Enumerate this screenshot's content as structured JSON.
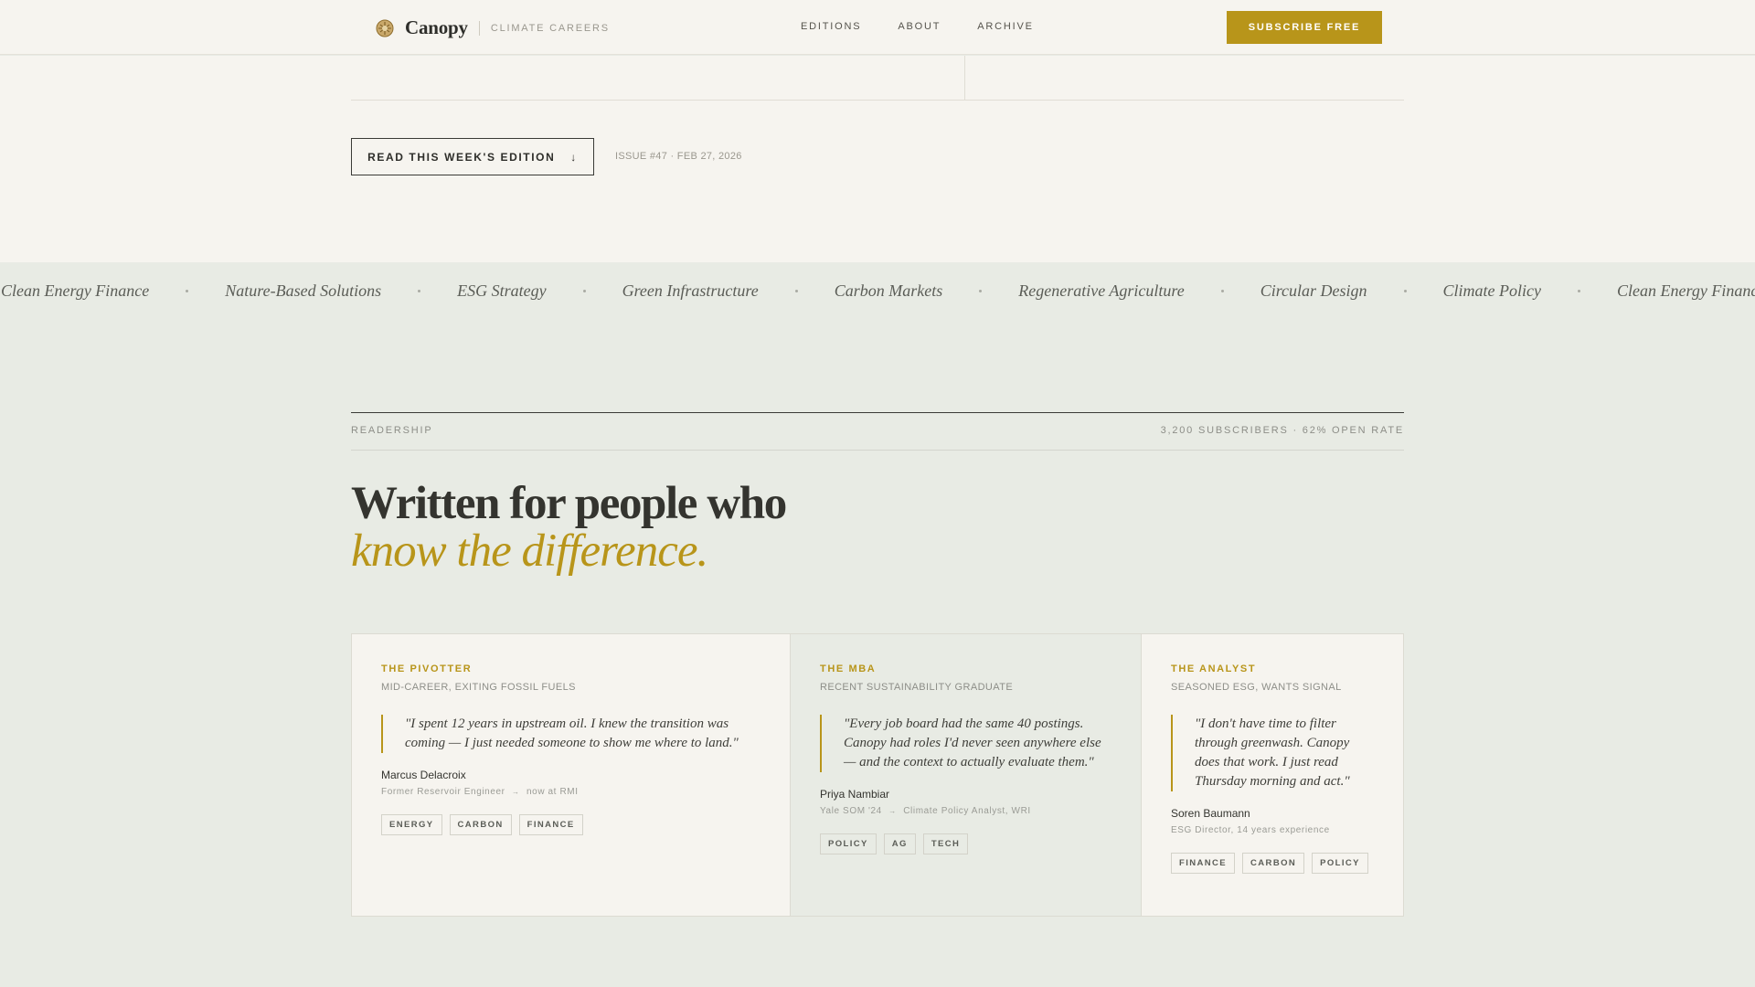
{
  "nav": {
    "brand": "Canopy",
    "tagline": "CLIMATE CAREERS",
    "links": [
      "EDITIONS",
      "ABOUT",
      "ARCHIVE"
    ],
    "cta": "SUBSCRIBE FREE",
    "logo_icon": "leaf-emblem-icon",
    "accent": "#b8951a"
  },
  "hero": {
    "read_button": "READ THIS WEEK'S EDITION",
    "read_arrow": "↓",
    "issue": "ISSUE #47 · FEB 27, 2026"
  },
  "ticker": [
    "Clean Energy Finance",
    "Nature-Based Solutions",
    "ESG Strategy",
    "Green Infrastructure",
    "Carbon Markets",
    "Regenerative Agriculture",
    "Circular Design",
    "Climate Policy",
    "Clean Energy Finance"
  ],
  "readership": {
    "label": "READERSHIP",
    "stats": "3,200 SUBSCRIBERS · 62% OPEN RATE",
    "headline": "Written for people who",
    "headline_em": "know the difference."
  },
  "cards": [
    {
      "role": "THE PIVOTTER",
      "subtitle": "MID-CAREER, EXITING FOSSIL FUELS",
      "quote": "\"I spent 12 years in upstream oil. I knew the transition was coming — I just needed someone to show me where to land.\"",
      "name": "Marcus Delacroix",
      "path_from": "Former Reservoir Engineer",
      "path_to": "now at RMI",
      "tags": [
        "ENERGY",
        "CARBON",
        "FINANCE"
      ]
    },
    {
      "role": "THE MBA",
      "subtitle": "RECENT SUSTAINABILITY GRADUATE",
      "quote": "\"Every job board had the same 40 postings. Canopy had roles I'd never seen anywhere else — and the context to actually evaluate them.\"",
      "name": "Priya Nambiar",
      "path_from": "Yale SOM '24",
      "path_to": "Climate Policy Analyst, WRI",
      "tags": [
        "POLICY",
        "AG",
        "TECH"
      ]
    },
    {
      "role": "THE ANALYST",
      "subtitle": "SEASONED ESG, WANTS SIGNAL",
      "quote": "\"I don't have time to filter through greenwash. Canopy does that work. I just read Thursday morning and act.\"",
      "name": "Soren Baumann",
      "path_from": "ESG Director, 14 years experience",
      "path_to": "",
      "tags": [
        "FINANCE",
        "CARBON",
        "POLICY"
      ]
    }
  ],
  "path_arrow": "→"
}
